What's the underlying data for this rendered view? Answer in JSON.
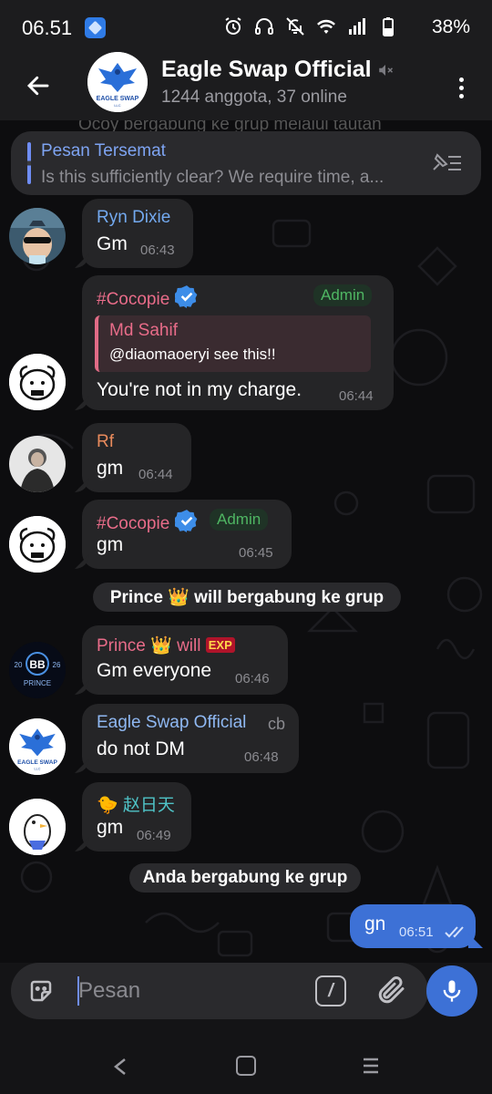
{
  "status_bar": {
    "time": "06.51",
    "battery": "38%"
  },
  "header": {
    "title": "Eagle Swap Official",
    "subtitle": "1244 anggota, 37 online",
    "avatar_text": "EAGLE SWAP",
    "avatar_sub": "LLC"
  },
  "chat": {
    "ghost_line": "Ocoy bergabung ke grup melalui tautan",
    "pinned": {
      "title": "Pesan Tersemat",
      "text": "Is this sufficiently clear? We require time, a..."
    },
    "messages": [
      {
        "sender": "Ryn Dixie",
        "sender_color": "#73a9ef",
        "text": "Gm",
        "time": "06:43"
      },
      {
        "sender": "#Cocopie",
        "sender_color": "#e86c89",
        "badge": "Admin",
        "reply_name": "Md Sahif",
        "reply_text": "@diaomaoeryi see this!!",
        "text": "You're not in my charge.",
        "time": "06:44"
      },
      {
        "sender": "Rf",
        "sender_color": "#e88a5c",
        "text": "gm",
        "time": "06:44"
      },
      {
        "sender": "#Cocopie",
        "sender_color": "#e86c89",
        "badge": "Admin",
        "text": "gm",
        "time": "06:45"
      },
      {
        "sender": "Prince 👑 will",
        "sender_color": "#e86c89",
        "text": "Gm everyone",
        "time": "06:46"
      },
      {
        "sender": "Eagle Swap Official",
        "sender_color": "#8fb8f2",
        "signature": "cb",
        "text": "do not DM",
        "time": "06:48"
      },
      {
        "sender": "🐤 赵日天",
        "sender_color": "#4fc3c7",
        "text": "gm",
        "time": "06:49"
      }
    ],
    "system_1": "Prince 👑 will bergabung ke grup",
    "system_2": "Anda bergabung ke grup",
    "outgoing": {
      "text": "gn",
      "time": "06:51"
    },
    "prince_avatar": {
      "top": "20",
      "bb": "BB",
      "right": "26",
      "label": "PRINCE"
    },
    "prince_badge": "EXP"
  },
  "composer": {
    "placeholder": "Pesan",
    "command_label": "/"
  },
  "colors": {
    "accent": "#3d71d6",
    "admin": "#4fb663",
    "bubble": "#252527"
  }
}
